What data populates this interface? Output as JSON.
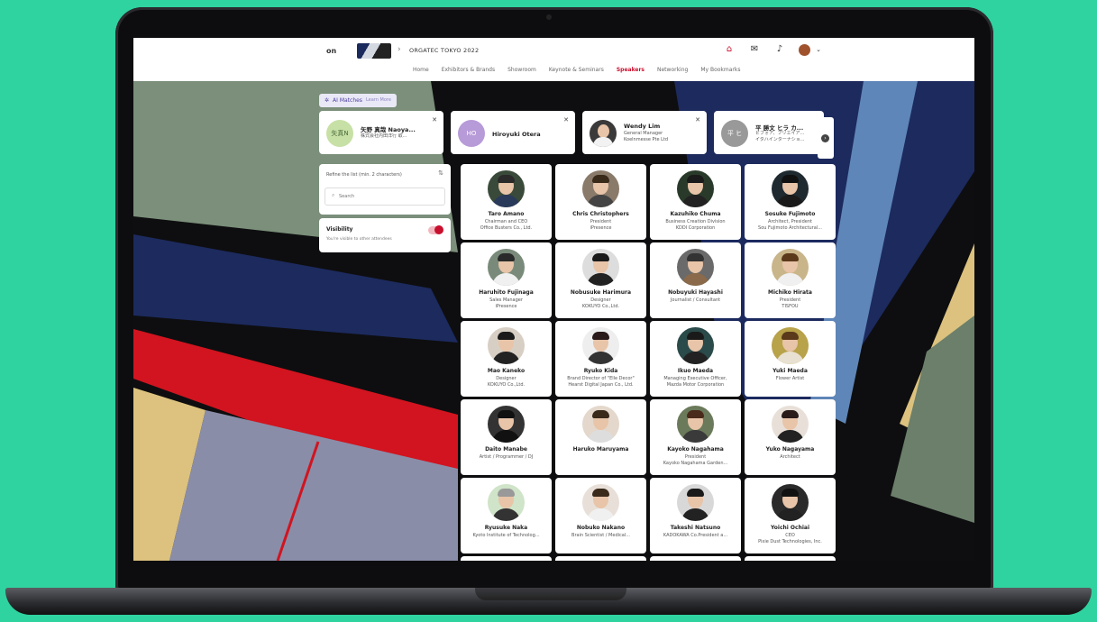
{
  "topbar": {
    "logo": "on",
    "event_title": "ORGATEC TOKYO 2022",
    "nav": [
      "Home",
      "Exhibitors & Brands",
      "Showroom",
      "Keynote & Seminars",
      "Speakers",
      "Networking",
      "My Bookmarks"
    ],
    "active_nav": "Speakers",
    "icons": [
      "home-icon",
      "chat-icon",
      "bell-icon",
      "user-avatar-icon"
    ]
  },
  "ai_matches": {
    "label": "AI Matches",
    "beta": "Learn More",
    "items": [
      {
        "initials": "矢真N",
        "name": "矢野 真哉 Naoya...",
        "sub": "株式会社内田洋行 取...",
        "color": "#c7e0a6"
      },
      {
        "initials": "HO",
        "name": "Hiroyuki Otera",
        "sub": "",
        "color": "#b79ad8"
      },
      {
        "initials": "",
        "name": "Wendy Lim",
        "sub": "General Manager",
        "sub2": "Koelnmesse Pte Ltd",
        "color": "#333"
      },
      {
        "initials": "平 ヒ",
        "name": "平 勝文 ヒラ カ...",
        "sub": "ビフォア、フリエイア...",
        "sub2": "イタハインターナショ...",
        "color": "#999"
      }
    ]
  },
  "refine": {
    "label": "Refine the list (min. 2 characters)",
    "search_placeholder": "Search",
    "search_value": ""
  },
  "visibility": {
    "title": "Visibility",
    "desc": "You're visible to other attendees",
    "enabled": true
  },
  "speakers": [
    {
      "name": "Taro Amano",
      "l1": "Chairman and CEO",
      "l2": "Office Busters Co., Ltd."
    },
    {
      "name": "Chris Christophers",
      "l1": "President",
      "l2": "iPresence"
    },
    {
      "name": "Kazuhiko Chuma",
      "l1": "Business Creation Division",
      "l2": "KDDI Corporation"
    },
    {
      "name": "Sosuke Fujimoto",
      "l1": "Architect, President",
      "l2": "Sou Fujimoto Architectural..."
    },
    {
      "name": "Haruhito Fujinaga",
      "l1": "Sales Manager",
      "l2": "iPresence"
    },
    {
      "name": "Nobusuke Harimura",
      "l1": "Designer",
      "l2": "KOKUYO Co.,Ltd."
    },
    {
      "name": "Nobuyuki Hayashi",
      "l1": "Journalist / Consultant",
      "l2": ""
    },
    {
      "name": "Michiko Hirata",
      "l1": "President",
      "l2": "TISFOU"
    },
    {
      "name": "Mao Kaneko",
      "l1": "Designer",
      "l2": "KOKUYO Co.,Ltd."
    },
    {
      "name": "Ryuko Kida",
      "l1": "Brand Director of \"Elle Decor\"",
      "l2": "Hearst Digital Japan Co., Ltd."
    },
    {
      "name": "Ikuo Maeda",
      "l1": "Managing Executive Officer,",
      "l2": "Mazda Motor Corporation"
    },
    {
      "name": "Yuki Maeda",
      "l1": "Flower Artist",
      "l2": ""
    },
    {
      "name": "Daito Manabe",
      "l1": "Artist / Programmer / DJ",
      "l2": ""
    },
    {
      "name": "Haruko Maruyama",
      "l1": "",
      "l2": ""
    },
    {
      "name": "Kayoko Nagahama",
      "l1": "President",
      "l2": "Kayoko Nagahama Garden..."
    },
    {
      "name": "Yuko Nagayama",
      "l1": "Architect",
      "l2": ""
    },
    {
      "name": "Ryusuke Naka",
      "l1": "Kyoto Institute of Technolog...",
      "l2": ""
    },
    {
      "name": "Nobuko Nakano",
      "l1": "Brain Scientist / Medical...",
      "l2": ""
    },
    {
      "name": "Takeshi Natsuno",
      "l1": "KADOKAWA Co.President a...",
      "l2": ""
    },
    {
      "name": "Yoichi Ochiai",
      "l1": "CEO",
      "l2": "Pixie Dust Technologies, Inc."
    }
  ],
  "colors": {
    "accent": "#c8102e",
    "device_bg": "#2fd39f"
  }
}
